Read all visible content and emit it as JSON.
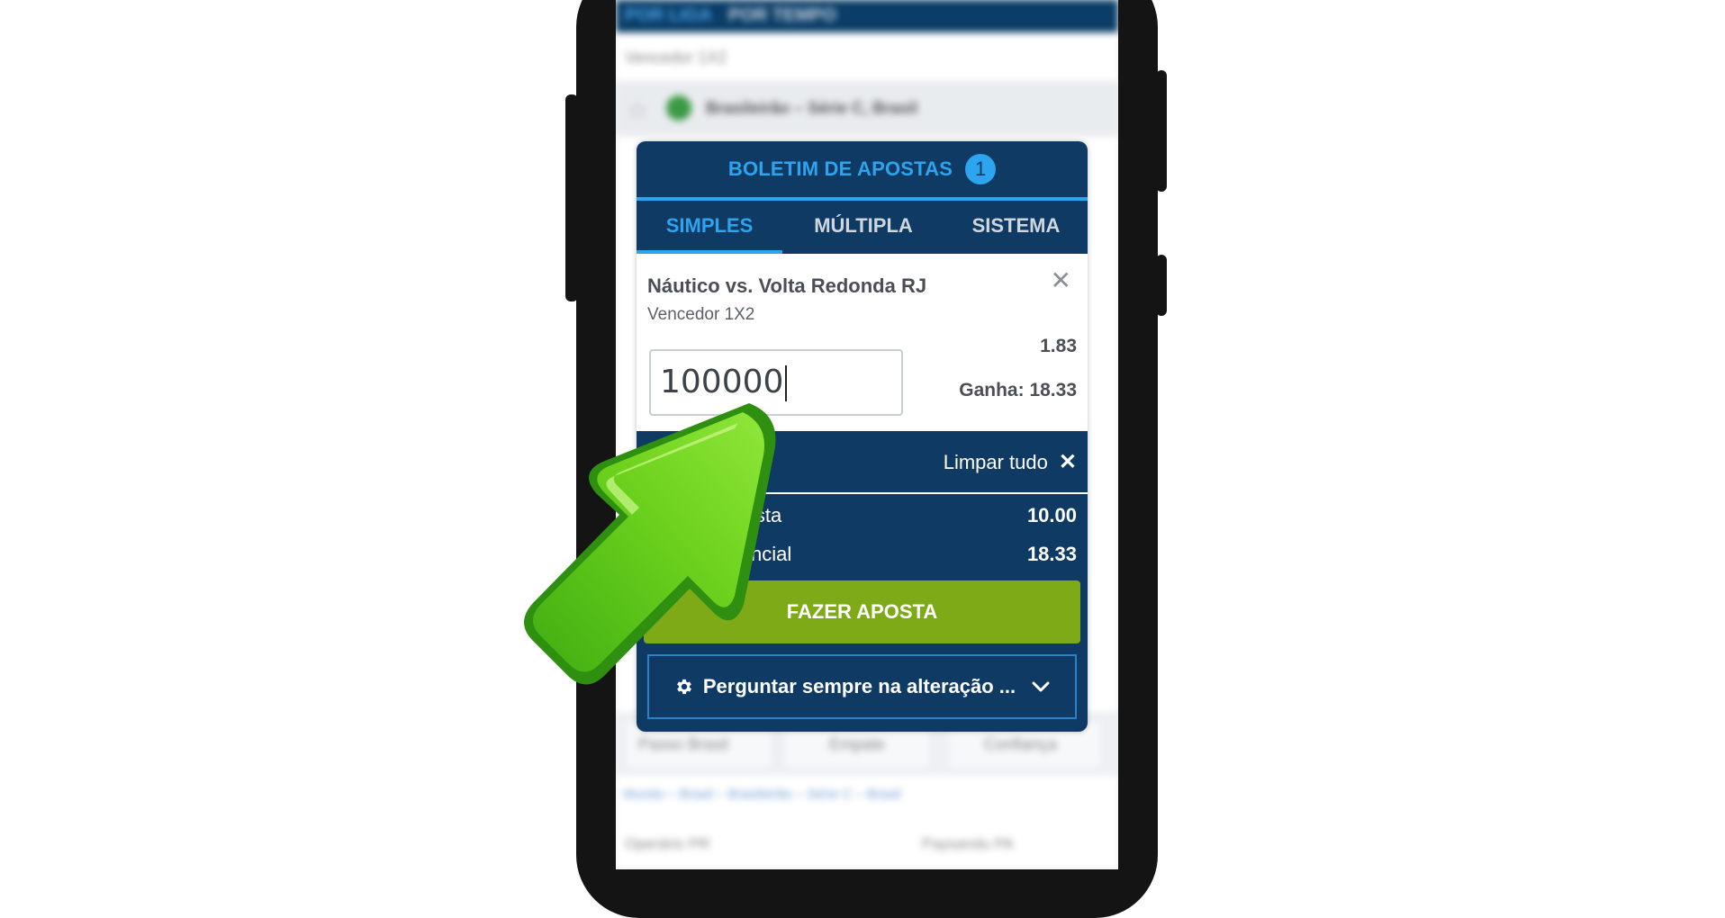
{
  "background_app": {
    "top_tabs": [
      "POR LIGA",
      "POR TEMPO"
    ],
    "market_selector": "Vencedor 1X2",
    "league_label": "Brasileirão – Série C, Brasil",
    "bottom_options": [
      "Passo Brasil",
      "Empate",
      "Confiança"
    ],
    "bottom_league_label": "Mundo – Brasil – Brasileirão – Série C – Brasil",
    "bottom_teams": [
      "Operário PR",
      "Paysandu PA"
    ]
  },
  "betslip": {
    "title": "BOLETIM DE APOSTAS",
    "count": "1",
    "tabs": [
      {
        "label": "SIMPLES",
        "active": true
      },
      {
        "label": "MÚLTIPLA",
        "active": false
      },
      {
        "label": "SISTEMA",
        "active": false
      }
    ],
    "selection": {
      "match": "Náutico vs. Volta Redonda RJ",
      "market": "Vencedor 1X2",
      "odds": "1.83",
      "stake_value": "100000",
      "gain": "Ganha: 18.33"
    },
    "clear_all_label": "Limpar tudo",
    "totals": [
      {
        "label": "Total de aposta",
        "value": "10.00"
      },
      {
        "label": "Ganho potencial",
        "value": "18.33"
      }
    ],
    "place_bet_label": "FAZER APOSTA",
    "preference_label": "Perguntar sempre na alteração ..."
  },
  "colors": {
    "header_bg": "#0f3a64",
    "accent_blue": "#2da4ee",
    "place_bet_green": "#7eaa17",
    "arrow_green": "#5cc61c"
  },
  "icons": [
    "close-icon",
    "gear-icon",
    "chevron-down-icon",
    "green-arrow-pointer-icon"
  ]
}
